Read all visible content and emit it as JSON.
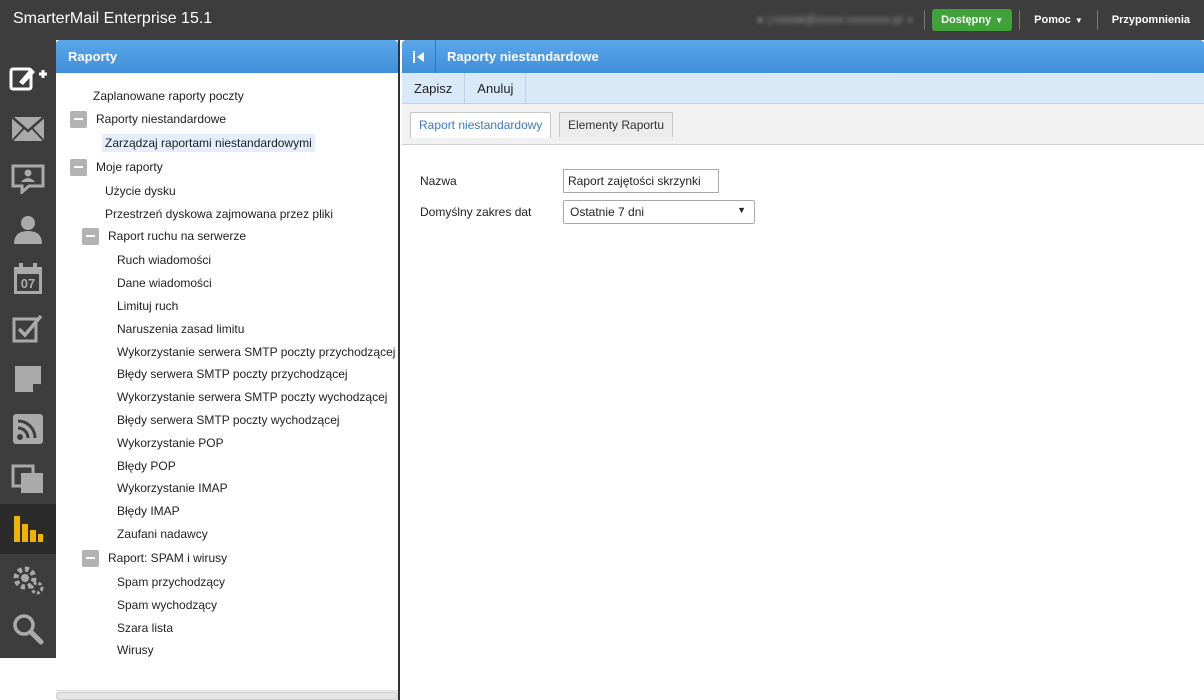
{
  "app": {
    "title": "SmarterMail Enterprise 15.1"
  },
  "topbar": {
    "user_email": "j.nowak@xxxxx.xxxxxxxx.pl",
    "status_label": "Dostępny",
    "help_label": "Pomoc",
    "reminders_label": "Przypomnienia"
  },
  "rail": {
    "items": [
      {
        "icon": "compose-icon"
      },
      {
        "icon": "mail-icon"
      },
      {
        "icon": "chat-icon"
      },
      {
        "icon": "contacts-icon"
      },
      {
        "icon": "calendar-icon",
        "day": "07"
      },
      {
        "icon": "tasks-icon"
      },
      {
        "icon": "notes-icon"
      },
      {
        "icon": "rss-icon"
      },
      {
        "icon": "files-icon"
      },
      {
        "icon": "reports-icon"
      },
      {
        "icon": "settings-icon"
      },
      {
        "icon": "search-icon"
      }
    ],
    "active_item": "reports-icon"
  },
  "left_panel": {
    "title": "Raporty",
    "tree": [
      {
        "label": "Zaplanowane raporty poczty",
        "level": 0,
        "toggle": false
      },
      {
        "label": "Raporty niestandardowe",
        "level": 0,
        "toggle": true
      },
      {
        "label": "Zarządzaj raportami niestandardowymi",
        "level": 1,
        "toggle": false,
        "selected": true
      },
      {
        "label": "Moje raporty",
        "level": 0,
        "toggle": true
      },
      {
        "label": "Użycie dysku",
        "level": 1,
        "toggle": false
      },
      {
        "label": "Przestrzeń dyskowa zajmowana przez pliki",
        "level": 1,
        "toggle": false
      },
      {
        "label": "Raport ruchu na serwerze",
        "level": 1,
        "toggle": true
      },
      {
        "label": "Ruch wiadomości",
        "level": 2,
        "toggle": false
      },
      {
        "label": "Dane wiadomości",
        "level": 2,
        "toggle": false
      },
      {
        "label": "Limituj ruch",
        "level": 2,
        "toggle": false
      },
      {
        "label": "Naruszenia zasad limitu",
        "level": 2,
        "toggle": false
      },
      {
        "label": "Wykorzystanie serwera SMTP poczty przychodzącej",
        "level": 2,
        "toggle": false
      },
      {
        "label": "Błędy serwera SMTP poczty przychodzącej",
        "level": 2,
        "toggle": false
      },
      {
        "label": "Wykorzystanie serwera SMTP poczty wychodzącej",
        "level": 2,
        "toggle": false
      },
      {
        "label": "Błędy serwera SMTP poczty wychodzącej",
        "level": 2,
        "toggle": false
      },
      {
        "label": "Wykorzystanie POP",
        "level": 2,
        "toggle": false
      },
      {
        "label": "Błędy POP",
        "level": 2,
        "toggle": false
      },
      {
        "label": "Wykorzystanie IMAP",
        "level": 2,
        "toggle": false
      },
      {
        "label": "Błędy IMAP",
        "level": 2,
        "toggle": false
      },
      {
        "label": "Zaufani nadawcy",
        "level": 2,
        "toggle": false
      },
      {
        "label": "Raport: SPAM i wirusy",
        "level": 1,
        "toggle": true
      },
      {
        "label": "Spam przychodzący",
        "level": 2,
        "toggle": false
      },
      {
        "label": "Spam wychodzący",
        "level": 2,
        "toggle": false
      },
      {
        "label": "Szara lista",
        "level": 2,
        "toggle": false
      },
      {
        "label": "Wirusy",
        "level": 2,
        "toggle": false
      }
    ]
  },
  "right_panel": {
    "title": "Raporty niestandardowe",
    "toolbar": {
      "save_label": "Zapisz",
      "cancel_label": "Anuluj"
    },
    "tabs": [
      {
        "label": "Raport niestandardowy",
        "active": true
      },
      {
        "label": "Elementy Raportu",
        "active": false
      }
    ],
    "form": {
      "name_label": "Nazwa",
      "name_value": "Raport zajętości skrzynki",
      "range_label": "Domyślny zakres dat",
      "range_value": "Ostatnie 7 dni"
    }
  },
  "colors": {
    "topbar": "#3d3d3d",
    "header_blue": "#4a9be3",
    "status_green": "#3fa33a",
    "reports_icon": "#f0b400",
    "toolbar_bg": "#d9e9f8"
  }
}
